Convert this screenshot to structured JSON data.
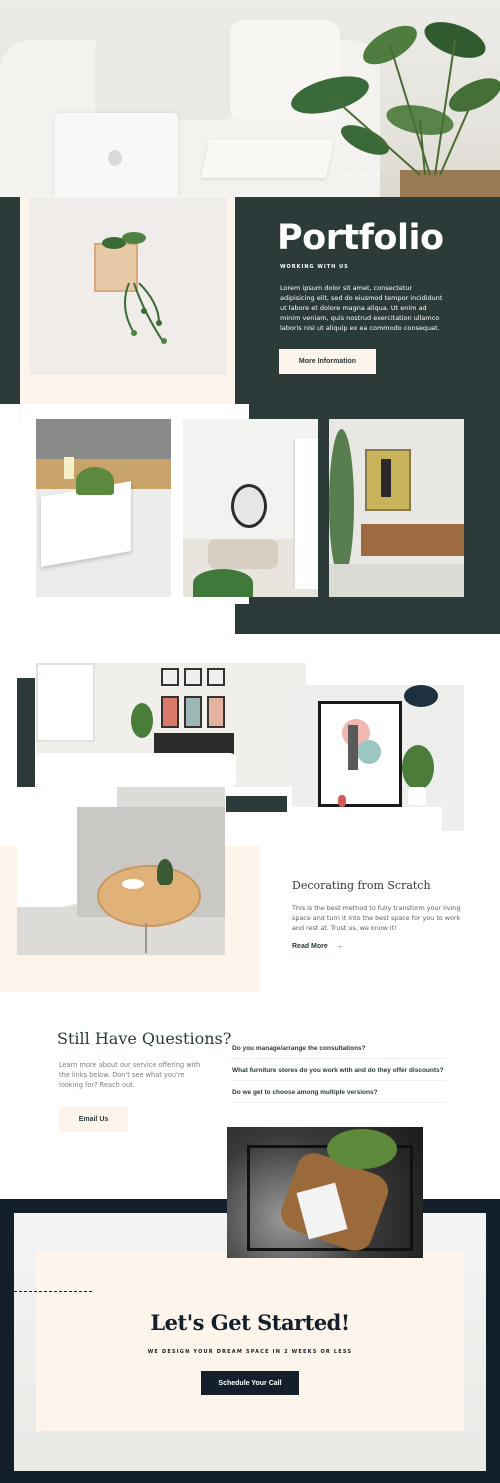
{
  "hero": {
    "caption": "BEDROOM"
  },
  "portfolio": {
    "title": "Portfolio",
    "subtitle": "WORKING WITH US",
    "body": "Lorem ipsum dolor sit amet, consectetur adipisicing elit, sed do eiusmod tempor incididunt ut labore et dolore magna aliqua. Ut enim ad minim veniam, quis nostrud exercitation ullamco laboris nisi ut aliquip ex ea commodo consequat.",
    "button": "More Information"
  },
  "decorating": {
    "title": "Decorating from Scratch",
    "body": "This is the best method to fully transform your living space and turn it into the best space for you to work and rest at. Trust us, we know it!",
    "link": "Read More",
    "link_arrow": "→"
  },
  "faq": {
    "title": "Still Have Questions?",
    "body": "Learn more about our service offering with the links below. Don't see what you're looking for? Reach out.",
    "button": "Email Us",
    "questions": [
      "Do you manage/arrange the consultations?",
      "What furniture stores do you work with and do they offer discounts?",
      "Do we get to choose among multiple versions?"
    ]
  },
  "cta": {
    "title": "Let's Get Started!",
    "subtitle": "WE DESIGN YOUR DREAM SPACE IN 2 WEEKS OR LESS",
    "button": "Schedule Your Call"
  },
  "colors": {
    "dark_green": "#2c3a39",
    "navy": "#13202c",
    "cream": "#fdf5ec",
    "white": "#ffffff"
  }
}
